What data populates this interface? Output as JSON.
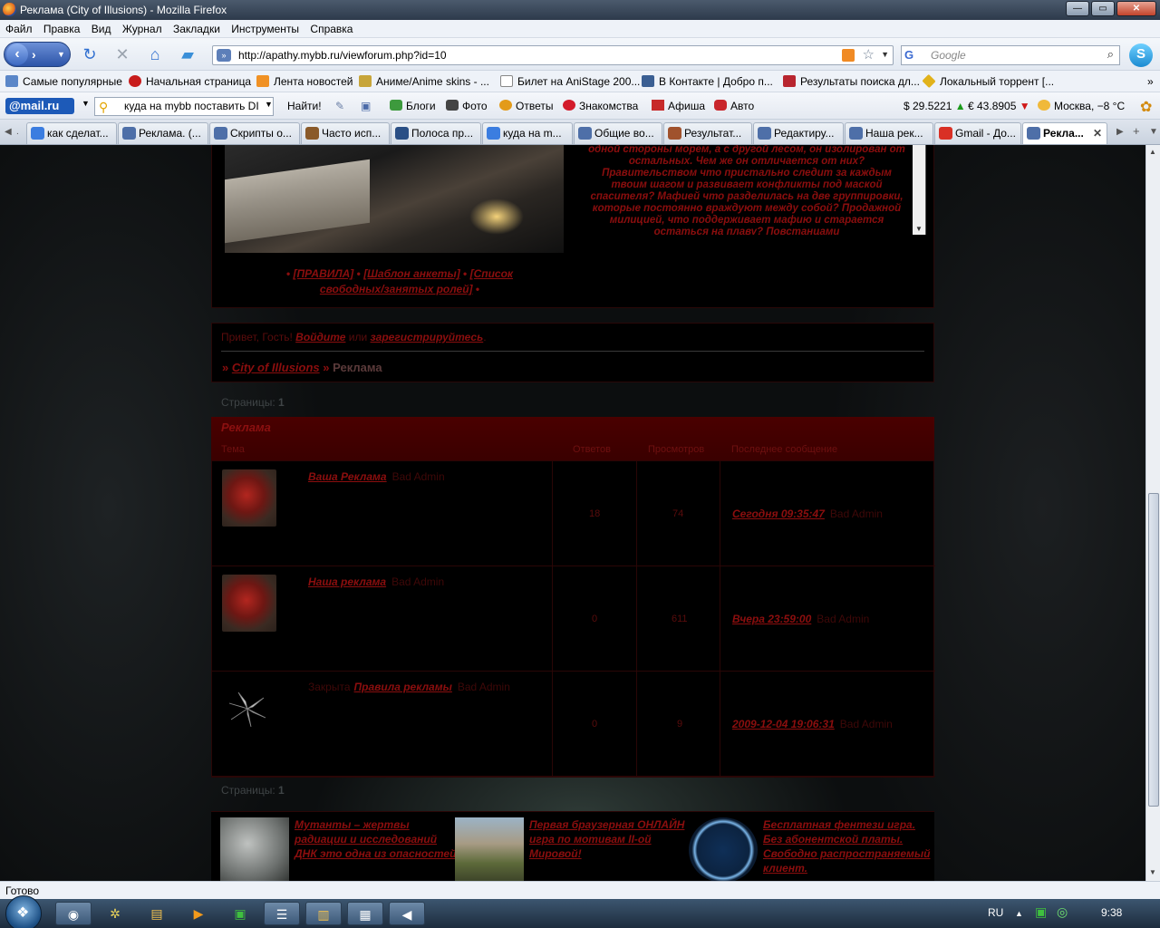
{
  "window": {
    "title": "Реклама (City of Illusions) - Mozilla Firefox",
    "buttons": [
      "—",
      "▭",
      "✕"
    ]
  },
  "menu": [
    "Файл",
    "Правка",
    "Вид",
    "Журнал",
    "Закладки",
    "Инструменты",
    "Справка"
  ],
  "nav": {
    "url": "http://apathy.mybb.ru/viewforum.php?id=10",
    "search_placeholder": "Google"
  },
  "bookmarks": [
    "Самые популярные",
    "Начальная страница",
    "Лента новостей",
    "Аниме/Anime skins - ...",
    "Билет на AniStage 200...",
    "В Контакте | Добро п...",
    "Результаты поиска дл...",
    "Локальный торрент [..."
  ],
  "mailru": {
    "logo": "@mail.ru",
    "search_value": "куда на mybb поставить DI",
    "find_label": "Найти!",
    "links": [
      "Блоги",
      "Фото",
      "Ответы",
      "Знакомства",
      "Афиша",
      "Авто"
    ],
    "usd": "$ 29.5221",
    "usd_trend": "▲",
    "eur": "€ 43.8905",
    "eur_trend": "▼",
    "weather": "Москва, −8 °C"
  },
  "tabs": [
    "как сделат...",
    "Реклама. (...",
    "Скрипты о...",
    "Часто исп...",
    "Полоса пр...",
    "куда на m...",
    "Общие во...",
    "Результат...",
    "Редактиру...",
    "Наша рек...",
    "Gmail - До...",
    "Рекла..."
  ],
  "page": {
    "story_text": "одной стороны морем, а с другой лесом, он изолирован от остальных. Чем же он отличается от них? Правительством что пристально следит за каждым твоим шагом и развивает конфликты под маской спасителя? Мафией что разделилась на две группировки, которые постоянно враждуют между собой? Продажной милицией, что поддерживает мафию и старается остаться на плаву? Повстанцами",
    "rules_links": [
      "[ПРАВИЛА]",
      "[Шаблон анкеты]",
      "[Список свободных/занятых ролей]"
    ],
    "hello_prefix": "Привет, Гость!",
    "login": "Войдите",
    "or": "или",
    "register": "зарегистрируйтесь",
    "hello_end": ".",
    "crumb_arrow": "»",
    "crumb_forum": "City of Illusions",
    "crumb_current": "Реклама",
    "pages_label": "Страницы:",
    "pages_value": "1"
  },
  "forum": {
    "title": "Реклама",
    "columns": {
      "topic": "Тема",
      "replies": "Ответов",
      "views": "Просмотров",
      "last": "Последнее сообщение"
    },
    "topics": [
      {
        "prefix": "",
        "title": "Ваша Реклама",
        "author": "Bad Admin",
        "replies": "18",
        "views": "74",
        "last_date": "Сегодня 09:35:47",
        "last_author": "Bad Admin"
      },
      {
        "prefix": "",
        "title": "Наша реклама",
        "author": "Bad Admin",
        "replies": "0",
        "views": "611",
        "last_date": "Вчера 23:59:00",
        "last_author": "Bad Admin"
      },
      {
        "prefix": "Закрыта",
        "title": "Правила рекламы",
        "author": "Bad Admin",
        "replies": "0",
        "views": "9",
        "last_date": "2009-12-04 19:06:31",
        "last_author": "Bad Admin"
      }
    ]
  },
  "ads": [
    "Мутанты – жертвы радиации и исследований ДНК это одна из опасностей",
    "Первая браузерная ОНЛАЙН игра по мотивам II-ой Мировой!",
    "Бесплатная фентези игра. Без абонентской платы. Свободно распространяемый клиент."
  ],
  "status": "Готово",
  "tray": {
    "lang": "RU",
    "time": "9:38"
  }
}
